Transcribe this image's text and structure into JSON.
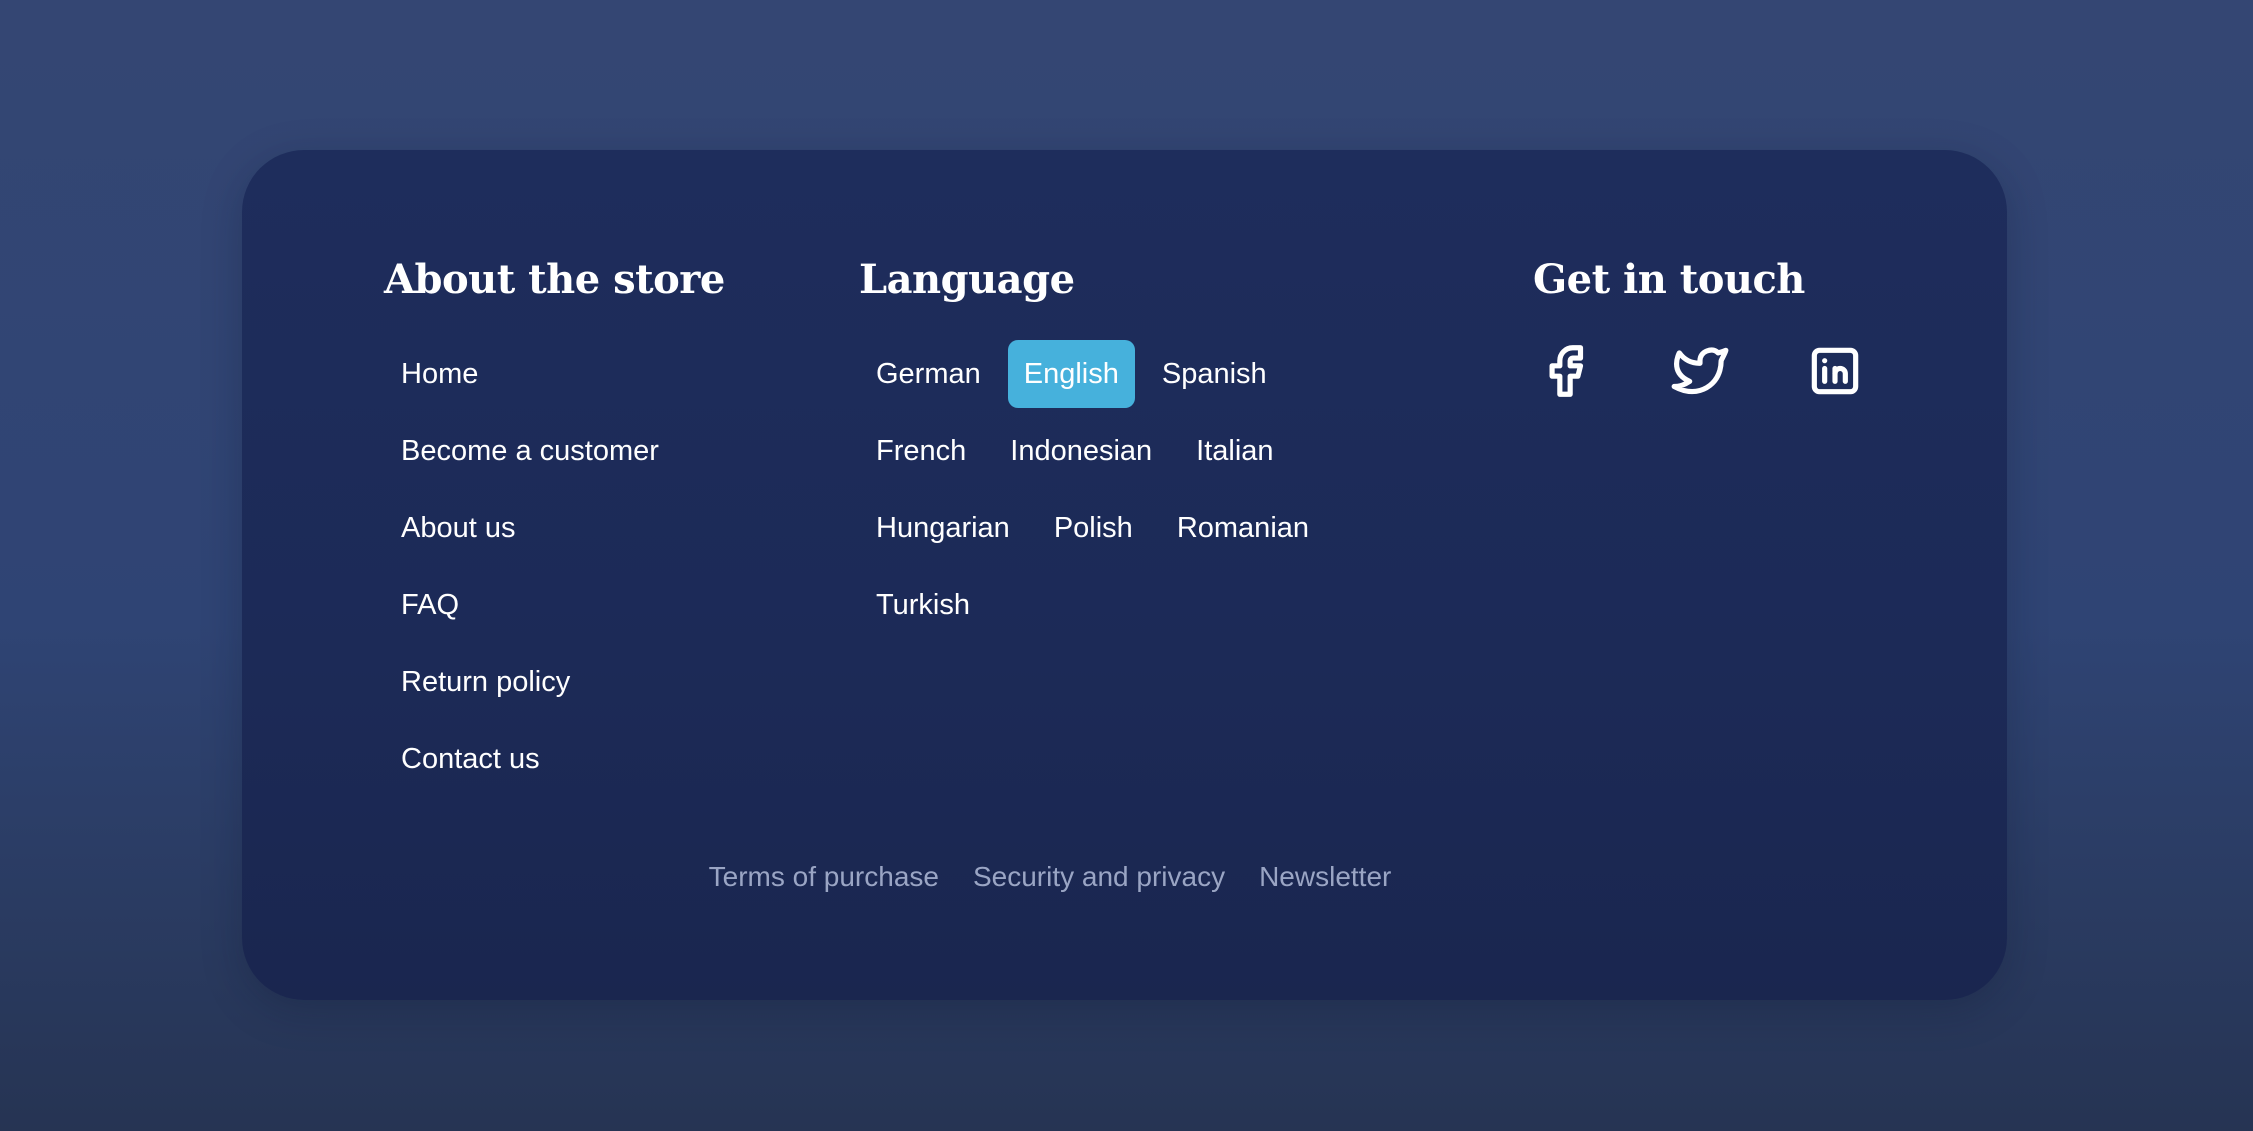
{
  "about": {
    "heading": "About the store",
    "links": [
      {
        "label": "Home"
      },
      {
        "label": "Become a customer"
      },
      {
        "label": "About us"
      },
      {
        "label": "FAQ"
      },
      {
        "label": "Return policy"
      },
      {
        "label": "Contact us"
      }
    ]
  },
  "language": {
    "heading": "Language",
    "selected": "English",
    "rows": [
      [
        "German",
        "English",
        "Spanish"
      ],
      [
        "French",
        "Indonesian",
        "Italian"
      ],
      [
        "Hungarian",
        "Polish",
        "Romanian"
      ],
      [
        "Turkish"
      ]
    ]
  },
  "contact": {
    "heading": "Get in touch",
    "social": [
      {
        "icon": "facebook-icon"
      },
      {
        "icon": "twitter-icon"
      },
      {
        "icon": "linkedin-icon"
      }
    ]
  },
  "footer_links": [
    {
      "label": "Terms of purchase"
    },
    {
      "label": "Security and privacy"
    },
    {
      "label": "Newsletter"
    }
  ],
  "colors": {
    "active_language_bg": "#46b1dc",
    "card_bg": "#1e2d5c",
    "page_bg": "#344673",
    "muted_link": "#9aa5c4"
  }
}
